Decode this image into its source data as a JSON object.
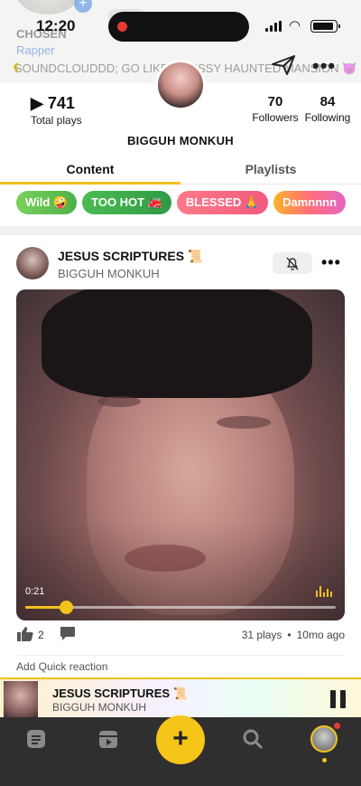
{
  "status_bar": {
    "time": "12:20"
  },
  "profile_header": {
    "name": "CHOSEN",
    "role": "Rapper",
    "bio": "SOUNDCLOUDDD; GO LIKE A PUSSY HAUNTED MANSION 😈 BIG FUH BITCH❤️"
  },
  "stats": {
    "plays": "741",
    "plays_label": "Total plays",
    "followers": "70",
    "followers_label": "Followers",
    "following": "84",
    "following_label": "Following"
  },
  "artist_name": "BIGGUH MONKUH",
  "tabs": [
    {
      "label": "Content",
      "active": true
    },
    {
      "label": "Playlists",
      "active": false
    }
  ],
  "reaction_chips": [
    {
      "label": "Wild 🤪"
    },
    {
      "label": "TOO HOT 🚒"
    },
    {
      "label": "BLESSED 🙏"
    },
    {
      "label": "Damnnnn"
    }
  ],
  "post": {
    "title": "JESUS SCRIPTURES 📜",
    "artist": "BIGGUH MONKUH",
    "elapsed": "0:21",
    "progress": 0.13,
    "likes": "2",
    "plays": "31 plays",
    "dot": "•",
    "age": "10mo ago",
    "quick_reaction_label": "Add Quick reaction"
  },
  "mini_player": {
    "title": "JESUS SCRIPTURES 📜",
    "artist": "BIGGUH MONKUH"
  },
  "bottom_nav": {
    "fab_label": "+"
  },
  "colors": {
    "accent": "#f3c21b",
    "nav_bg": "#2f2f2f",
    "link_blue": "#2f6fd2"
  }
}
